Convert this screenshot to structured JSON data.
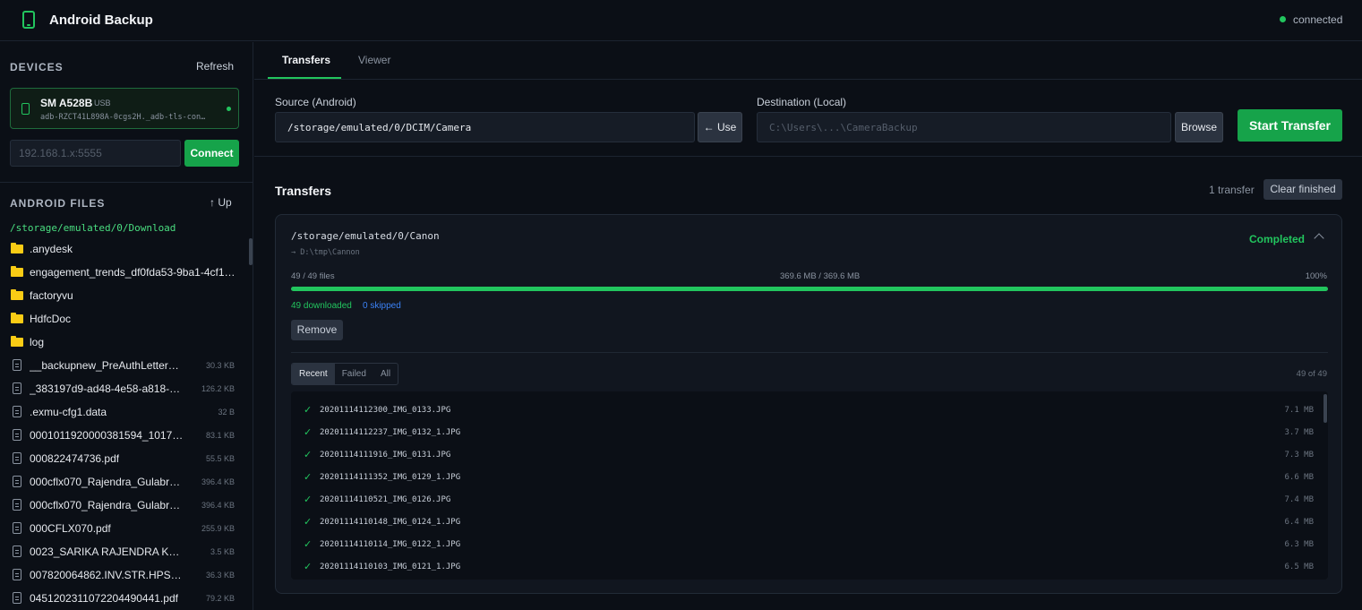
{
  "header": {
    "title": "Android Backup",
    "status": "connected"
  },
  "colors": {
    "accent": "#22c55e",
    "button_primary": "#16a34a",
    "folder": "#facc15",
    "skipped": "#3b82f6",
    "background": "#0b0f16"
  },
  "sidebar": {
    "devices_title": "DEVICES",
    "refresh_label": "Refresh",
    "device": {
      "name": "SM A528B",
      "connection": "USB",
      "serial": "adb-RZCT41L898A-0cgs2H._adb-tls-con…"
    },
    "ip_placeholder": "192.168.1.x:5555",
    "connect_label": "Connect",
    "files_title": "ANDROID FILES",
    "up_label": "↑ Up",
    "current_path": "/storage/emulated/0/Download",
    "files": [
      {
        "name": ".anydesk",
        "type": "folder",
        "size": ""
      },
      {
        "name": "engagement_trends_df0fda53-9ba1-4cf1-…",
        "type": "folder",
        "size": ""
      },
      {
        "name": "factoryvu",
        "type": "folder",
        "size": ""
      },
      {
        "name": "HdfcDoc",
        "type": "folder",
        "size": ""
      },
      {
        "name": "log",
        "type": "folder",
        "size": ""
      },
      {
        "name": "__backupnew_PreAuthLetters_Add…",
        "type": "file",
        "size": "30.3 KB"
      },
      {
        "name": "_383197d9-ad48-4e58-a818-c3e…",
        "type": "file",
        "size": "126.2 KB"
      },
      {
        "name": ".exmu-cfg1.data",
        "type": "file",
        "size": "32 B"
      },
      {
        "name": "0001011920000381594_10172020…",
        "type": "file",
        "size": "83.1 KB"
      },
      {
        "name": "000822474736.pdf",
        "type": "file",
        "size": "55.5 KB"
      },
      {
        "name": "000cflx070_Rajendra_Gulabrao_K…",
        "type": "file",
        "size": "396.4 KB"
      },
      {
        "name": "000cflx070_Rajendra_Gulabrao_K…",
        "type": "file",
        "size": "396.4 KB"
      },
      {
        "name": "000CFLX070.pdf",
        "type": "file",
        "size": "255.9 KB"
      },
      {
        "name": "0023_SARIKA RAJENDRA KHOPE.pdf",
        "type": "file",
        "size": "3.5 KB"
      },
      {
        "name": "007820064862.INV.STR.HPS.CST.2…",
        "type": "file",
        "size": "36.3 KB"
      },
      {
        "name": "04512023110722044904​41.pdf",
        "type": "file",
        "size": "79.2 KB"
      }
    ]
  },
  "tabs": [
    {
      "label": "Transfers",
      "active": true
    },
    {
      "label": "Viewer",
      "active": false
    }
  ],
  "form": {
    "source_label": "Source (Android)",
    "source_value": "/storage/emulated/0/DCIM/Camera",
    "use_label": "← Use",
    "dest_label": "Destination (Local)",
    "dest_placeholder": "C:\\Users\\...\\CameraBackup",
    "browse_label": "Browse",
    "start_label": "Start Transfer"
  },
  "transfers": {
    "title": "Transfers",
    "count_text": "1 transfer",
    "clear_label": "Clear finished",
    "items": [
      {
        "source": "/storage/emulated/0/Canon",
        "dest": "→ D:\\tmp\\Cannon",
        "status": "Completed",
        "files_text": "49 / 49 files",
        "bytes_text": "369.6 MB / 369.6 MB",
        "percent_text": "100%",
        "progress": 1.0,
        "downloaded_text": "49 downloaded",
        "skipped_text": "0 skipped",
        "remove_label": "Remove",
        "filters": [
          "Recent",
          "Failed",
          "All"
        ],
        "active_filter": "Recent",
        "list_count": "49 of 49",
        "files": [
          {
            "name": "20201114112300_IMG_0133.JPG",
            "size": "7.1 MB"
          },
          {
            "name": "20201114112237_IMG_0132_1.JPG",
            "size": "3.7 MB"
          },
          {
            "name": "20201114111916_IMG_0131.JPG",
            "size": "7.3 MB"
          },
          {
            "name": "20201114111352_IMG_0129_1.JPG",
            "size": "6.6 MB"
          },
          {
            "name": "20201114110521_IMG_0126.JPG",
            "size": "7.4 MB"
          },
          {
            "name": "20201114110148_IMG_0124_1.JPG",
            "size": "6.4 MB"
          },
          {
            "name": "20201114110114_IMG_0122_1.JPG",
            "size": "6.3 MB"
          },
          {
            "name": "20201114110103_IMG_0121_1.JPG",
            "size": "6.5 MB"
          }
        ]
      }
    ]
  },
  "icons": {
    "app": "phone-icon",
    "folder": "folder-icon",
    "file": "file-icon",
    "check": "check-icon",
    "collapse": "chevron-up-icon"
  }
}
